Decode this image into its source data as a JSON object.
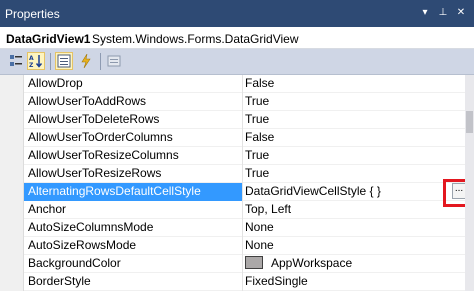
{
  "window": {
    "title": "Properties"
  },
  "object": {
    "name": "DataGridView1",
    "type": "System.Windows.Forms.DataGridView"
  },
  "toolbar": {
    "buttons": [
      "categorized-icon",
      "alphabetical-icon",
      "properties-icon",
      "events-icon",
      "property-pages-icon"
    ],
    "active": "alphabetical-icon"
  },
  "properties": [
    {
      "name": "AllowDrop",
      "value": "False"
    },
    {
      "name": "AllowUserToAddRows",
      "value": "True"
    },
    {
      "name": "AllowUserToDeleteRows",
      "value": "True"
    },
    {
      "name": "AllowUserToOrderColumns",
      "value": "False"
    },
    {
      "name": "AllowUserToResizeColumns",
      "value": "True"
    },
    {
      "name": "AllowUserToResizeRows",
      "value": "True"
    },
    {
      "name": "AlternatingRowsDefaultCellStyle",
      "value": "DataGridViewCellStyle { }",
      "selected": true,
      "button": "..."
    },
    {
      "name": "Anchor",
      "value": "Top, Left"
    },
    {
      "name": "AutoSizeColumnsMode",
      "value": "None"
    },
    {
      "name": "AutoSizeRowsMode",
      "value": "None"
    },
    {
      "name": "BackgroundColor",
      "value": "AppWorkspace",
      "swatch": "#aba8a8"
    },
    {
      "name": "BorderStyle",
      "value": "FixedSingle"
    }
  ],
  "colors": {
    "titlebar": "#2e4a74",
    "selection": "#3399ff",
    "highlight_box": "#e3171f"
  }
}
